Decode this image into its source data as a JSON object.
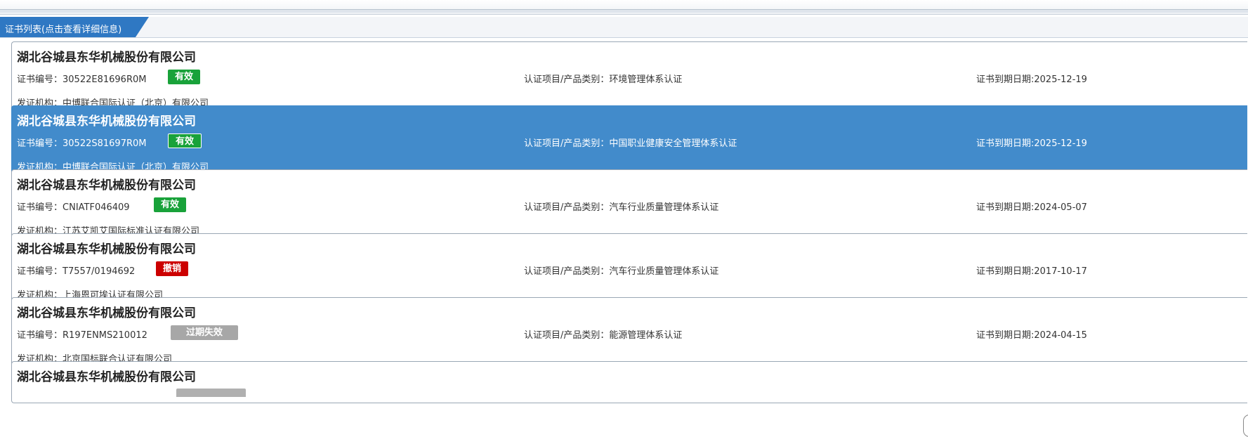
{
  "tab": {
    "label": "证书列表(点击查看详细信息)"
  },
  "labels": {
    "cert_no": "证书编号：",
    "project": "认证项目/产品类别：",
    "expiry": "证书到期日期:",
    "issuer": "发证机构："
  },
  "status_colors": {
    "有效": "#19a23a",
    "撤销": "#cc0000",
    "过期失效": "#a7a7a7"
  },
  "selected_index": 1,
  "certificates": [
    {
      "company": "湖北谷城县东华机械股份有限公司",
      "cert_no": "30522E81696R0M",
      "status": "有效",
      "project": "环境管理体系认证",
      "expiry": "2025-12-19",
      "issuer": "中博联合国际认证（北京）有限公司"
    },
    {
      "company": "湖北谷城县东华机械股份有限公司",
      "cert_no": "30522S81697R0M",
      "status": "有效",
      "project": "中国职业健康安全管理体系认证",
      "expiry": "2025-12-19",
      "issuer": "中博联合国际认证（北京）有限公司"
    },
    {
      "company": "湖北谷城县东华机械股份有限公司",
      "cert_no": "CNIATF046409",
      "status": "有效",
      "project": "汽车行业质量管理体系认证",
      "expiry": "2024-05-07",
      "issuer": "江苏艾凯艾国际标准认证有限公司"
    },
    {
      "company": "湖北谷城县东华机械股份有限公司",
      "cert_no": "T7557/0194692",
      "status": "撤销",
      "project": "汽车行业质量管理体系认证",
      "expiry": "2017-10-17",
      "issuer": "上海恩可埃认证有限公司"
    },
    {
      "company": "湖北谷城县东华机械股份有限公司",
      "cert_no": "R197ENMS210012",
      "status": "过期失效",
      "project": "能源管理体系认证",
      "expiry": "2024-04-15",
      "issuer": "北京国标联合认证有限公司"
    },
    {
      "company": "湖北谷城县东华机械股份有限公司"
    }
  ]
}
